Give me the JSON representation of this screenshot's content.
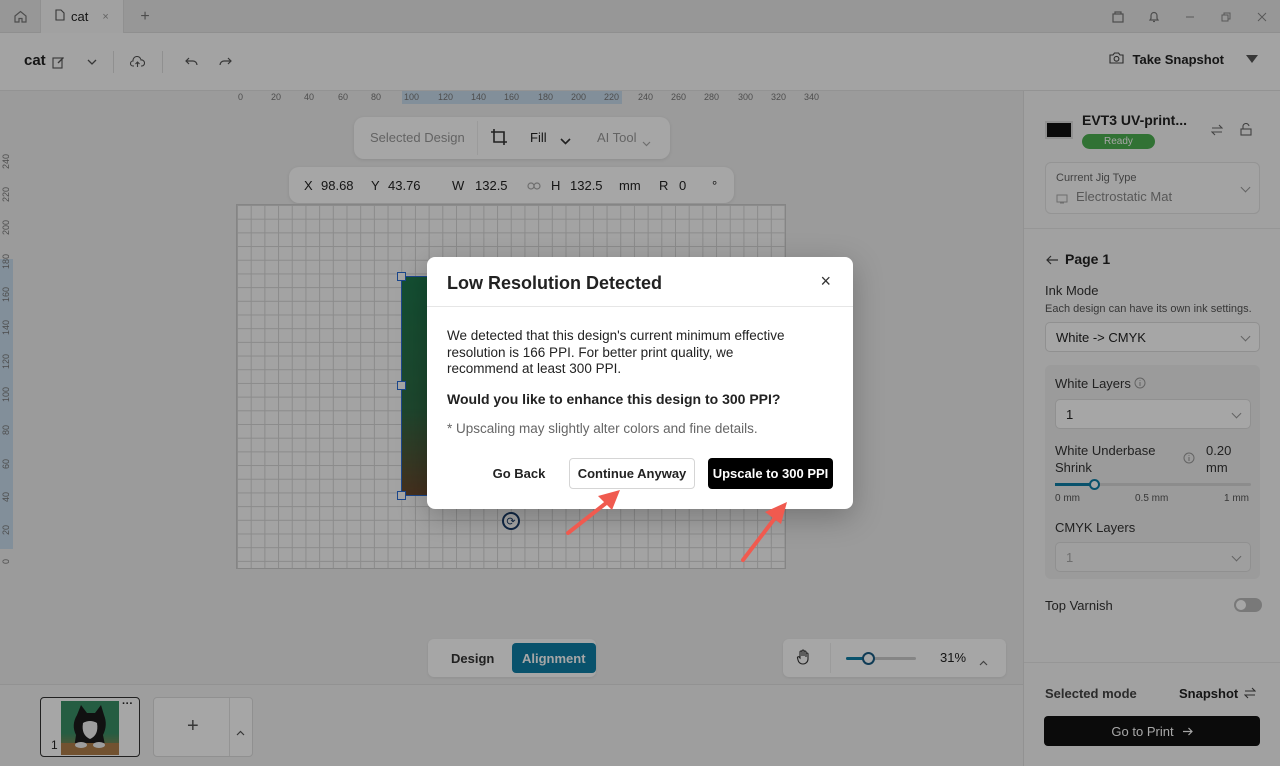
{
  "titlebar": {
    "tab_label": "cat",
    "tab_close": "×",
    "add_tab": "+"
  },
  "toolbar": {
    "project_name": "cat",
    "snapshot_label": "Take Snapshot"
  },
  "ruler": {
    "top_ticks": [
      "0",
      "20",
      "40",
      "60",
      "80",
      "100",
      "120",
      "140",
      "160",
      "180",
      "200",
      "220",
      "240",
      "260",
      "280",
      "300",
      "320",
      "340"
    ],
    "left_ticks": [
      "240",
      "220",
      "200",
      "180",
      "160",
      "140",
      "120",
      "100",
      "80",
      "60",
      "40",
      "20",
      "0"
    ]
  },
  "design_toolbar": {
    "selected_label": "Selected Design",
    "fill_label": "Fill",
    "ai_tool_label": "AI Tool"
  },
  "transform": {
    "x_label": "X",
    "x_value": "98.68",
    "y_label": "Y",
    "y_value": "43.76",
    "w_label": "W",
    "w_value": "132.5",
    "h_label": "H",
    "h_value": "132.5",
    "unit": "mm",
    "r_label": "R",
    "r_value": "0",
    "deg": "°"
  },
  "bottom_tabs": {
    "design": "Design",
    "alignment": "Alignment"
  },
  "zoom": {
    "value": "31%",
    "level_fraction": 0.31
  },
  "pages": {
    "thumb_number": "1",
    "more": "···",
    "add": "+"
  },
  "panel": {
    "printer_name": "EVT3 UV-print...",
    "status": "Ready",
    "jig_label": "Current Jig Type",
    "jig_value": "Electrostatic Mat",
    "page_title": "Page 1",
    "ink_mode_label": "Ink Mode",
    "ink_mode_help": "Each design can have its own ink settings.",
    "ink_mode_value": "White -> CMYK",
    "white_layers_label": "White Layers",
    "white_layers_value": "1",
    "shrink_label_1": "White Underbase",
    "shrink_label_2": "Shrink",
    "shrink_value": "0.20",
    "shrink_unit": "mm",
    "shrink_fraction": 0.2,
    "slider_min": "0 mm",
    "slider_mid": "0.5 mm",
    "slider_max": "1 mm",
    "cmyk_layers_label": "CMYK Layers",
    "cmyk_layers_value": "1",
    "top_varnish_label": "Top Varnish",
    "selected_mode_label": "Selected mode",
    "selected_mode_value": "Snapshot",
    "go_print_label": "Go to Print"
  },
  "modal": {
    "title": "Low Resolution Detected",
    "close": "×",
    "body_1": "We detected that this design's current minimum effective",
    "body_2": "resolution is 166 PPI. For better print quality, we",
    "body_3": "recommend at least 300 PPI.",
    "question": "Would you like to enhance this design to 300 PPI?",
    "note": "* Upscaling may slightly alter colors and fine details.",
    "go_back": "Go Back",
    "continue": "Continue Anyway",
    "upscale": "Upscale to 300 PPI"
  },
  "colors": {
    "accent": "#0e7fa6",
    "primary_button": "#000000",
    "annotation_arrow": "#f05a4f",
    "ready_green": "#4caf50"
  }
}
